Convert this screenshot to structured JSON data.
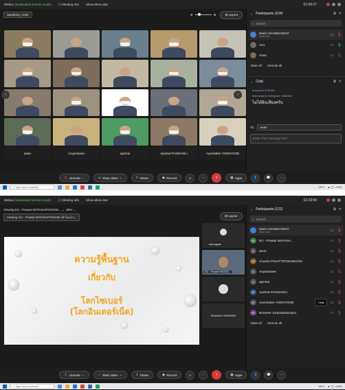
{
  "colors": {
    "bg": "#1b1b1b",
    "panel": "#212121",
    "leave": "#d63a3a",
    "muted": "#e05050",
    "slide_text": "#f0a41c"
  },
  "shot1": {
    "titlebar": {
      "app": "Webex",
      "status": "(Moderated unmute mode)",
      "meeting_info": "Meeting Info",
      "show_menu": "Show Menu Bar",
      "time": "02:08:27"
    },
    "speaking": "Speaking: Anan",
    "layout": "Layout",
    "tile_names": [
      "anan",
      "Anyamanee",
      "apichai",
      "Apichat PUNGHOLI",
      "Aunchalee YOENYOOB"
    ],
    "tile_colors": [
      "#8a7c5e",
      "#9b9b95",
      "#6b7f8c",
      "#b79a6e",
      "#c6c2b6",
      "#a59a88",
      "#7d6d5a",
      "#c3b8a4",
      "#a8b0a0",
      "#7b8c9a",
      "#877b6b",
      "#9d927f",
      "#ffffff",
      "#6a6f79",
      "#b1a795",
      "#5e6b56",
      "#c9b27c",
      "#4e9b63",
      "#8c7a66",
      "#d8d0bd"
    ],
    "participants": {
      "title": "Participants (104)",
      "search_placeholder": "Search",
      "items": [
        {
          "name": "Darin CHAMNANKIT",
          "sub": "Host, me",
          "initials": "",
          "color": "#4b7bd1"
        },
        {
          "name": "ACL",
          "sub": "",
          "initials": "",
          "color": "#6b6b6b"
        },
        {
          "name": "Anan",
          "sub": "",
          "initials": "",
          "color": "#7d6b55"
        }
      ],
      "mute_all": "Mute all",
      "unmute_all": "Unmute all"
    },
    "chat": {
      "title": "Chat",
      "meta": "Everyone 9:08 AM",
      "from": "from anan to everyone:   9:08 AM",
      "text": "ไม่ได้ยินเสียงครับ",
      "to_label": "To:",
      "to_value": "Anan",
      "placeholder": "Enter chat message here"
    },
    "controls": {
      "unmute": "Unmute",
      "stop_video": "Stop video",
      "share": "Share",
      "record": "Record",
      "apps": "Apps"
    }
  },
  "shot2": {
    "titlebar": {
      "app": "Webex",
      "status": "(Moderated unmute mode)",
      "meeting_info": "Meeting Info",
      "show_menu": "Show Menu Bar",
      "time": "02:39:58"
    },
    "viewing": "Viewing KU - Prawat WATANAPONGSE...",
    "zoom": "56%",
    "viewing_label": "Viewing: KU - Prawat WATANAPONGSE (ห้าโมง) 1...",
    "layout": "Layout",
    "slide": {
      "line1": "ความรู้พื้นฐาน",
      "line2": "เกี่ยวกับ",
      "line3": "โลกไซเบอร์",
      "line4": "(โลกอินเตอร์เน็ต)"
    },
    "strip": [
      "narongsak",
      "KU - Prawat WATAN...",
      "",
      "Khanitha CHANNUIN"
    ],
    "participants": {
      "title": "Participants (122)",
      "search_placeholder": "Search",
      "items": [
        {
          "name": "Darin CHAMNANKIT",
          "sub": "Host, me",
          "initials": "",
          "color": "#4b7bd1"
        },
        {
          "name": "KU - Prawat WATANA...",
          "sub": "",
          "initials": "KU",
          "color": "#3a7d44"
        },
        {
          "name": "anon",
          "sub": "",
          "initials": "A",
          "color": "#555"
        },
        {
          "name": "Anucha PISUTTIPONGBOON",
          "sub": "",
          "initials": "AP",
          "color": "#8a5a2b"
        },
        {
          "name": "Anyamanee",
          "sub": "",
          "initials": "A",
          "color": "#555"
        },
        {
          "name": "apichai",
          "sub": "",
          "initials": "A",
          "color": "#555"
        },
        {
          "name": "Apichat PUNGHOLI",
          "sub": "",
          "initials": "AP",
          "color": "#2b5a8a"
        },
        {
          "name": "Aunchalee YOENYOOB",
          "sub": "",
          "initials": "AY",
          "color": "#555"
        },
        {
          "name": "Boranee Junprapasorayut",
          "sub": "",
          "initials": "BJ",
          "color": "#7b3f8a"
        }
      ],
      "chat_tip": "Chat",
      "mute_all": "Mute all",
      "unmute_all": "Unmute all"
    },
    "controls": {
      "unmute": "Unmute",
      "start_video": "Start video",
      "share": "Share",
      "record": "Record",
      "apps": "Apps"
    }
  },
  "taskbar": {
    "search": "Type here to search",
    "weather": "28°C"
  }
}
